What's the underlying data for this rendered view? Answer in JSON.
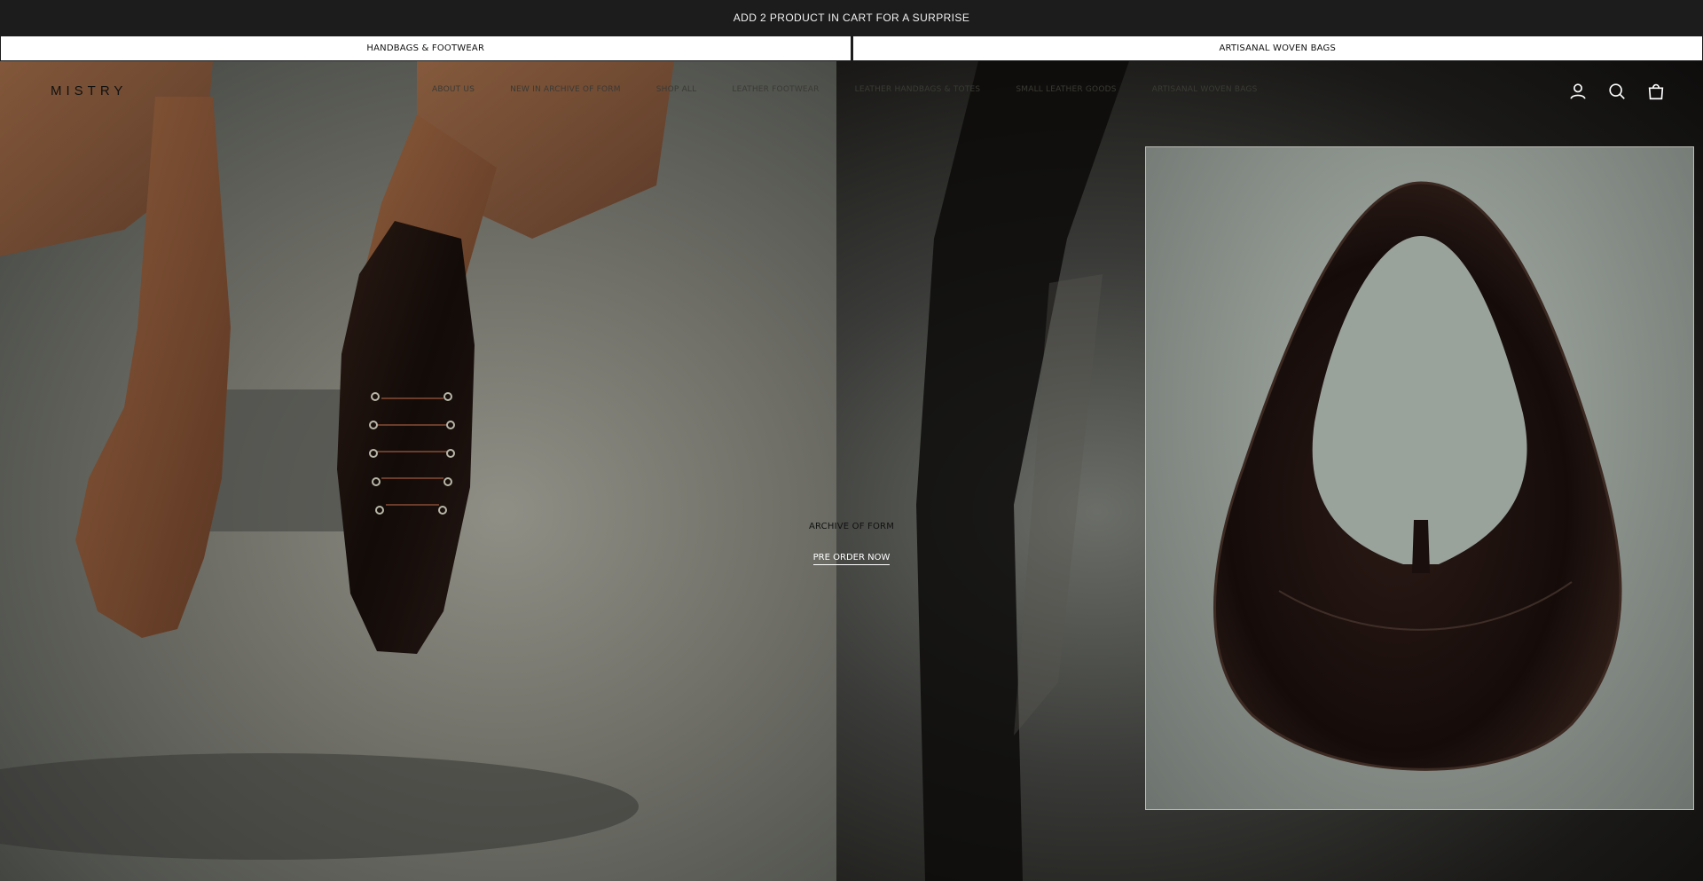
{
  "announcement": {
    "text": "ADD 2 PRODUCT IN CART FOR A SURPRISE"
  },
  "category_tabs": [
    {
      "label": "HANDBAGS & FOOTWEAR"
    },
    {
      "label": "ARTISANAL WOVEN BAGS"
    }
  ],
  "header": {
    "logo": "MISTRY",
    "menu": [
      {
        "label": "ABOUT US"
      },
      {
        "label": "NEW IN ARCHIVE OF FORM"
      },
      {
        "label": "SHOP ALL"
      },
      {
        "label": "LEATHER FOOTWEAR"
      },
      {
        "label": "LEATHER HANDBAGS & TOTES"
      },
      {
        "label": "SMALL LEATHER GOODS"
      },
      {
        "label": "ARTISANAL WOVEN BAGS"
      }
    ],
    "icons": [
      "account-icon",
      "search-icon",
      "cart-icon"
    ]
  },
  "hero": {
    "title": "ARCHIVE OF FORM",
    "cta": "PRE ORDER NOW"
  },
  "colors": {
    "bar_background": "#1c1c1c",
    "text_dark": "#111111",
    "text_light": "#ffffff",
    "leather": "#1a0f0c"
  }
}
